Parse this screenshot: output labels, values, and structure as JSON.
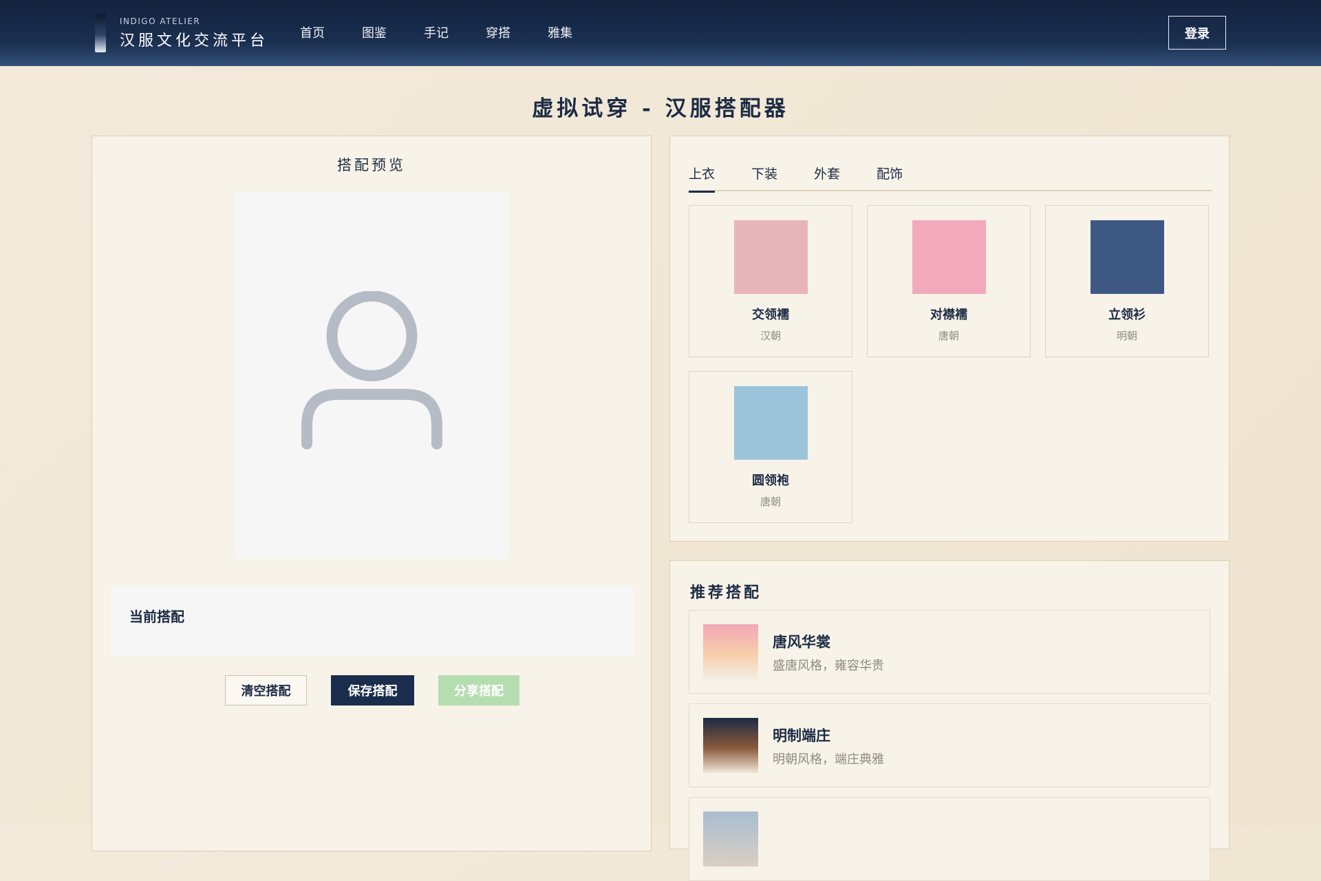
{
  "header": {
    "logo_en": "INDIGO ATELIER",
    "logo_cn": "汉服文化交流平台",
    "nav": [
      "首页",
      "图鉴",
      "手记",
      "穿搭",
      "雅集"
    ],
    "login_label": "登录"
  },
  "page_title": "虚拟试穿 - 汉服搭配器",
  "preview": {
    "title": "搭配预览",
    "avatar_icon": "user-icon",
    "current_label": "当前搭配",
    "buttons": {
      "clear": "清空搭配",
      "save": "保存搭配",
      "share": "分享搭配"
    }
  },
  "wardrobe": {
    "tabs": [
      "上衣",
      "下装",
      "外套",
      "配饰"
    ],
    "active_tab": 0,
    "items": [
      {
        "name": "交领襦",
        "era": "汉朝",
        "color": "#e6b5ba"
      },
      {
        "name": "对襟襦",
        "era": "唐朝",
        "color": "#f2a9bb"
      },
      {
        "name": "立领衫",
        "era": "明朝",
        "color": "#3d5883"
      },
      {
        "name": "圆领袍",
        "era": "唐朝",
        "color": "#9cc5db"
      }
    ]
  },
  "recommend": {
    "title": "推荐搭配",
    "items": [
      {
        "name": "唐风华裳",
        "desc": "盛唐风格，雍容华贵",
        "colors": [
          "#f3a7b6",
          "#f6ceaa",
          "#f3eee4"
        ]
      },
      {
        "name": "明制端庄",
        "desc": "明朝风格，端庄典雅",
        "colors": [
          "#1d2a45",
          "#8c5a3c",
          "#f0e7da"
        ]
      }
    ]
  }
}
